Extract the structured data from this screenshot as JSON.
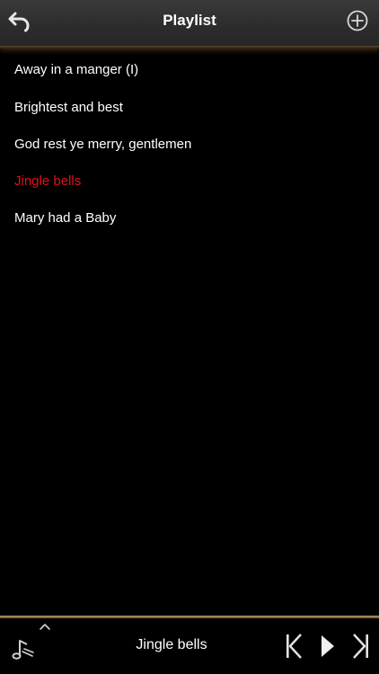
{
  "header": {
    "title": "Playlist",
    "back_icon": "back-arrow-icon",
    "add_icon": "plus-circle-icon"
  },
  "playlist": {
    "items": [
      {
        "label": "Away in a manger (I)",
        "active": false
      },
      {
        "label": "Brightest and best",
        "active": false
      },
      {
        "label": "God rest ye merry, gentlemen",
        "active": false
      },
      {
        "label": "Jingle bells",
        "active": true
      },
      {
        "label": "Mary had a Baby",
        "active": false
      }
    ],
    "active_color": "#e0101a"
  },
  "player": {
    "now_playing": "Jingle bells",
    "accent_color": "#b89a62",
    "icons": {
      "expand": "chevron-up-icon",
      "mode": "music-note-icon",
      "previous": "skip-previous-icon",
      "play": "play-icon",
      "next": "skip-next-icon"
    }
  }
}
